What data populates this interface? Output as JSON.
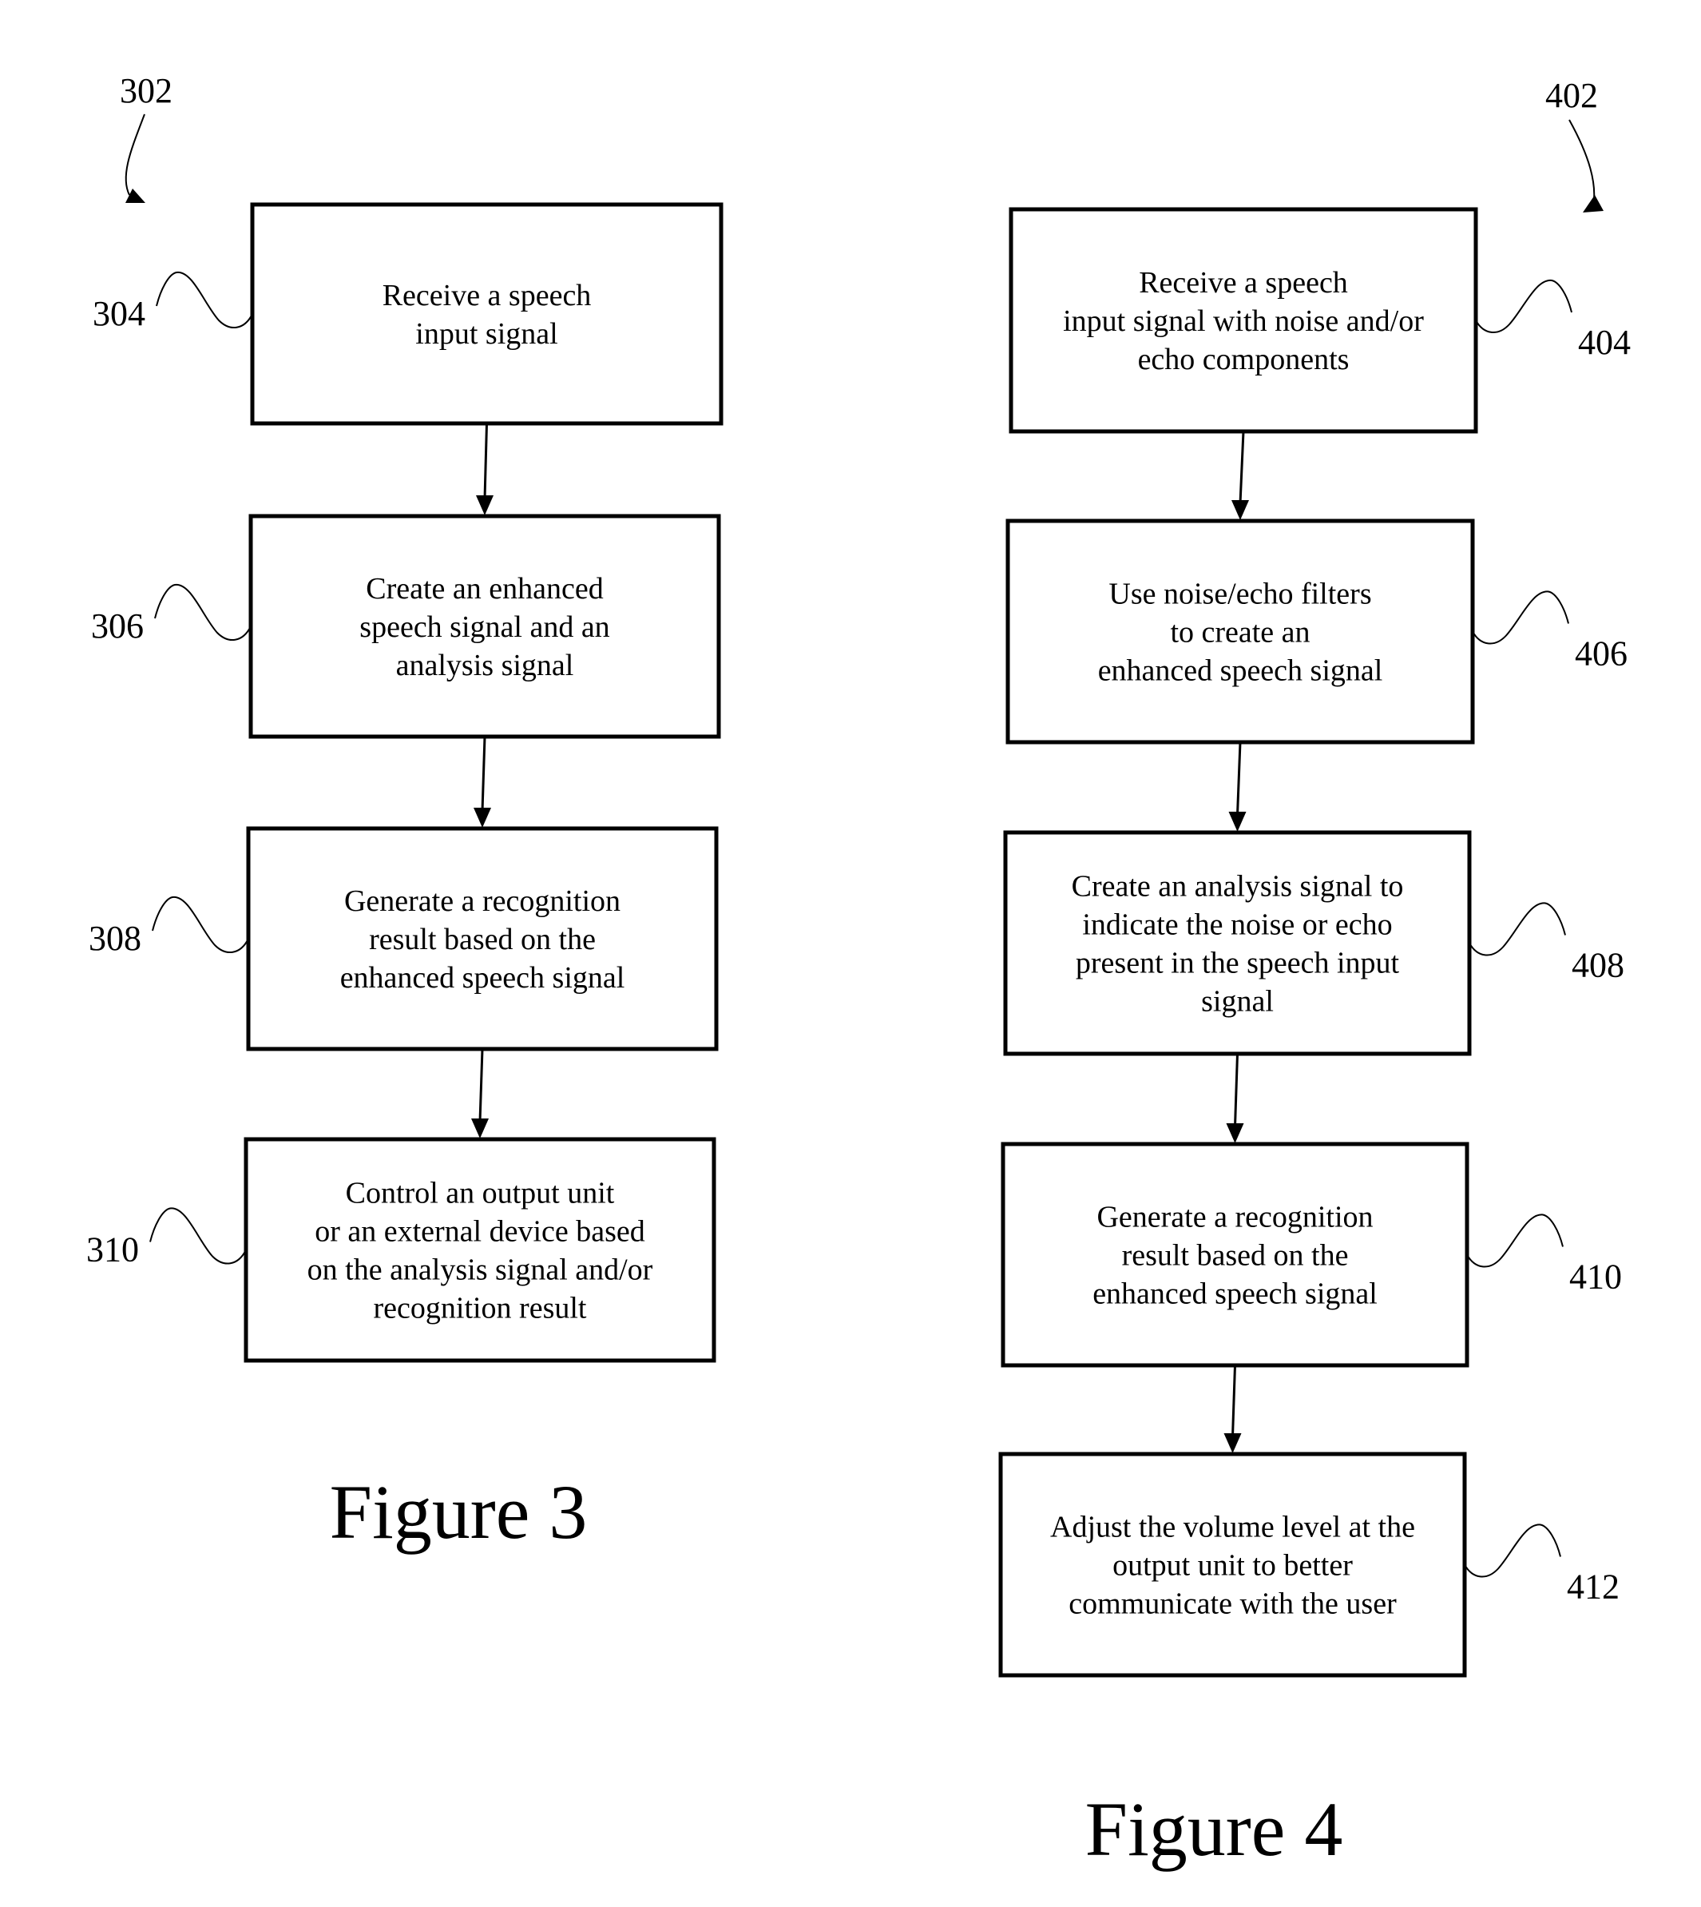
{
  "figures": [
    {
      "title": "Figure 3",
      "ref": "302",
      "steps": [
        {
          "ref": "304",
          "lines": [
            "Receive a speech",
            "input signal"
          ]
        },
        {
          "ref": "306",
          "lines": [
            "Create an enhanced",
            "speech signal and an",
            "analysis signal"
          ]
        },
        {
          "ref": "308",
          "lines": [
            "Generate a recognition",
            "result based on the",
            "enhanced speech signal"
          ]
        },
        {
          "ref": "310",
          "lines": [
            "Control an output unit",
            "or an external device based",
            "on the analysis signal and/or",
            "recognition result"
          ]
        }
      ]
    },
    {
      "title": "Figure 4",
      "ref": "402",
      "steps": [
        {
          "ref": "404",
          "lines": [
            "Receive a speech",
            "input signal with noise and/or",
            "echo components"
          ]
        },
        {
          "ref": "406",
          "lines": [
            "Use noise/echo filters",
            "to create an",
            "enhanced speech signal"
          ]
        },
        {
          "ref": "408",
          "lines": [
            "Create an analysis signal to",
            "indicate the noise or echo",
            "present in the speech input",
            "signal"
          ]
        },
        {
          "ref": "410",
          "lines": [
            "Generate a recognition",
            "result based on the",
            "enhanced speech signal"
          ]
        },
        {
          "ref": "412",
          "lines": [
            "Adjust the volume level at the",
            "output unit to better",
            "communicate with the user"
          ]
        }
      ]
    }
  ],
  "colors": {
    "ink": "#000000",
    "paper": "#ffffff"
  }
}
